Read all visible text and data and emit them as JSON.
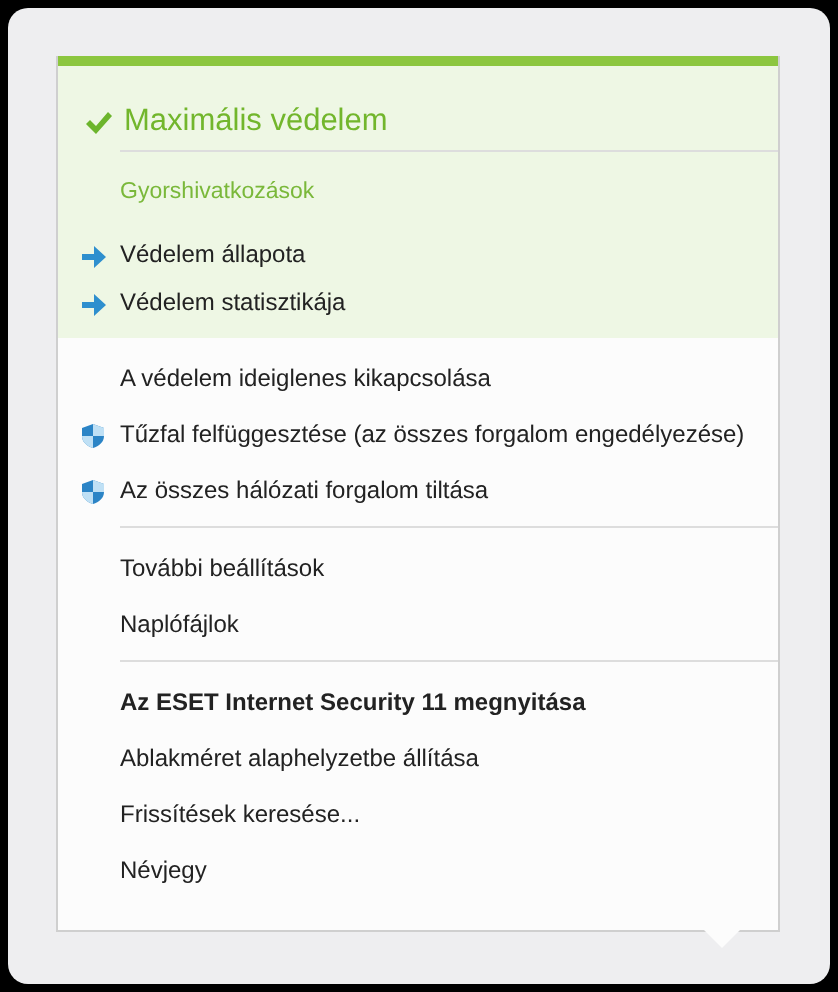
{
  "status": {
    "title": "Maximális védelem",
    "ok": true
  },
  "section_label": "Gyorshivatkozások",
  "quick_links": [
    {
      "label": "Védelem állapota",
      "kind": "arrow"
    },
    {
      "label": "Védelem statisztikája",
      "kind": "arrow"
    }
  ],
  "groups": [
    [
      {
        "label": "A védelem ideiglenes kikapcsolása",
        "kind": "plain",
        "bold": false
      },
      {
        "label": "Tűzfal felfüggesztése (az összes forgalom engedélyezése)",
        "kind": "shield",
        "bold": false
      },
      {
        "label": "Az összes hálózati forgalom tiltása",
        "kind": "shield",
        "bold": false
      }
    ],
    [
      {
        "label": "További beállítások",
        "kind": "plain",
        "bold": false
      },
      {
        "label": "Naplófájlok",
        "kind": "plain",
        "bold": false
      }
    ],
    [
      {
        "label": "Az ESET Internet Security 11 megnyitása",
        "kind": "plain",
        "bold": true
      },
      {
        "label": "Ablakméret alaphelyzetbe állítása",
        "kind": "plain",
        "bold": false
      },
      {
        "label": "Frissítések keresése...",
        "kind": "plain",
        "bold": false
      },
      {
        "label": "Névjegy",
        "kind": "plain",
        "bold": false
      }
    ]
  ]
}
